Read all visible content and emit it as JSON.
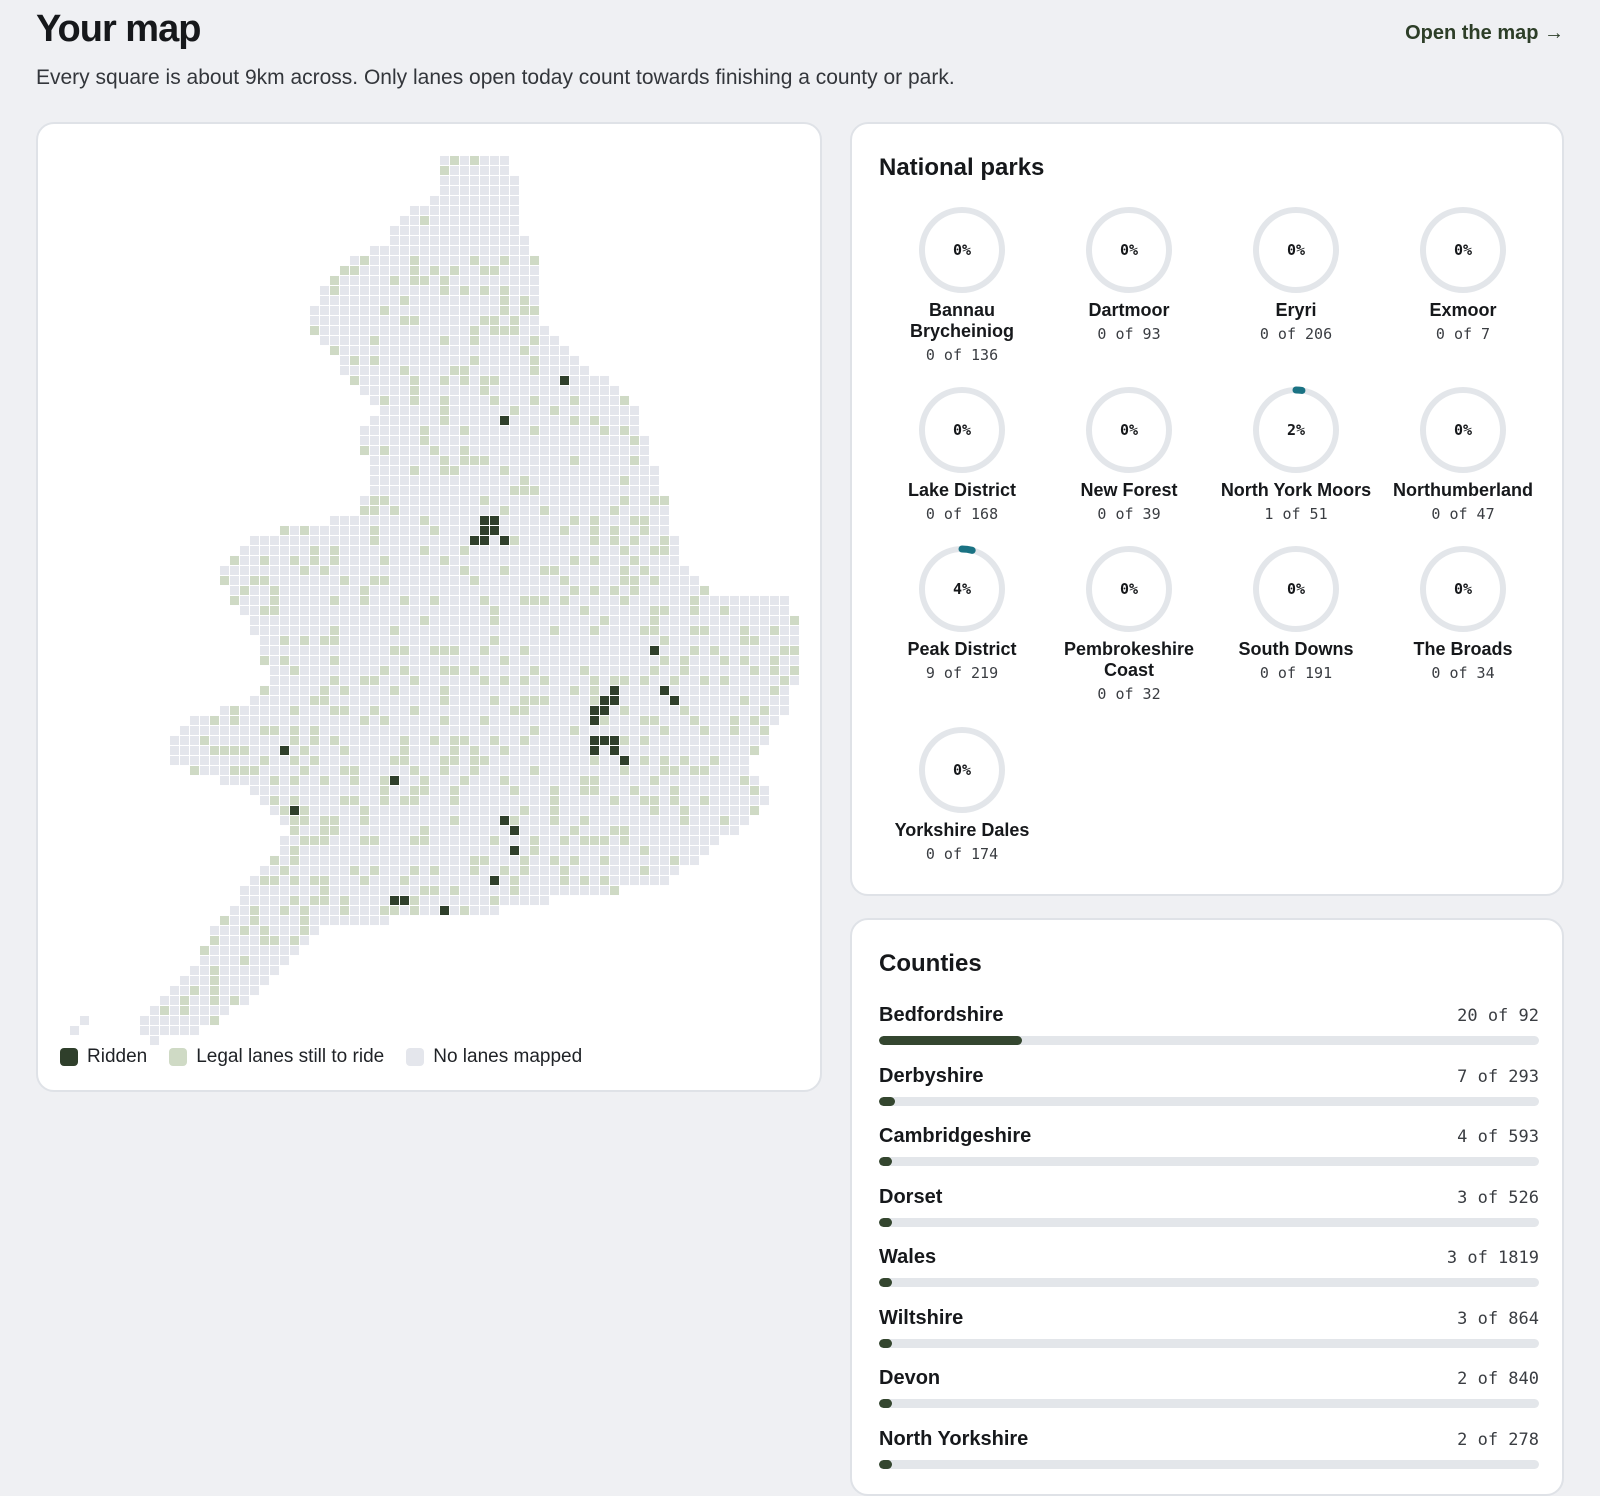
{
  "header": {
    "title": "Your map",
    "open_map_label": "Open the map →",
    "subtitle": "Every square is about 9km across. Only lanes open today count towards finishing a county or park."
  },
  "colors": {
    "ridden": "#2f3f2b",
    "legal": "#cfdac5",
    "none": "#e4e6ec",
    "park_accent": "#1a7283",
    "ring_track": "#e3e6ea"
  },
  "map": {
    "legend": [
      {
        "label": "Ridden",
        "key": "ridden"
      },
      {
        "label": "Legal lanes still to ride",
        "key": "legal"
      },
      {
        "label": "No lanes mapped",
        "key": "none"
      }
    ]
  },
  "parks": {
    "title": "National parks",
    "items": [
      {
        "name": "Bannau Brycheiniog",
        "pct_label": "0%",
        "count": "0 of 136",
        "ridden": 0,
        "total": 136
      },
      {
        "name": "Dartmoor",
        "pct_label": "0%",
        "count": "0 of 93",
        "ridden": 0,
        "total": 93
      },
      {
        "name": "Eryri",
        "pct_label": "0%",
        "count": "0 of 206",
        "ridden": 0,
        "total": 206
      },
      {
        "name": "Exmoor",
        "pct_label": "0%",
        "count": "0 of 7",
        "ridden": 0,
        "total": 7
      },
      {
        "name": "Lake District",
        "pct_label": "0%",
        "count": "0 of 168",
        "ridden": 0,
        "total": 168
      },
      {
        "name": "New Forest",
        "pct_label": "0%",
        "count": "0 of 39",
        "ridden": 0,
        "total": 39
      },
      {
        "name": "North York Moors",
        "pct_label": "2%",
        "count": "1 of 51",
        "ridden": 1,
        "total": 51
      },
      {
        "name": "Northumberland",
        "pct_label": "0%",
        "count": "0 of 47",
        "ridden": 0,
        "total": 47
      },
      {
        "name": "Peak District",
        "pct_label": "4%",
        "count": "9 of 219",
        "ridden": 9,
        "total": 219
      },
      {
        "name": "Pembrokeshire Coast",
        "pct_label": "0%",
        "count": "0 of 32",
        "ridden": 0,
        "total": 32
      },
      {
        "name": "South Downs",
        "pct_label": "0%",
        "count": "0 of 191",
        "ridden": 0,
        "total": 191
      },
      {
        "name": "The Broads",
        "pct_label": "0%",
        "count": "0 of 34",
        "ridden": 0,
        "total": 34
      },
      {
        "name": "Yorkshire Dales",
        "pct_label": "0%",
        "count": "0 of 174",
        "ridden": 0,
        "total": 174
      }
    ]
  },
  "counties": {
    "title": "Counties",
    "items": [
      {
        "name": "Bedfordshire",
        "count": "20 of 92",
        "ridden": 20,
        "total": 92
      },
      {
        "name": "Derbyshire",
        "count": "7 of 293",
        "ridden": 7,
        "total": 293
      },
      {
        "name": "Cambridgeshire",
        "count": "4 of 593",
        "ridden": 4,
        "total": 593
      },
      {
        "name": "Dorset",
        "count": "3 of 526",
        "ridden": 3,
        "total": 526
      },
      {
        "name": "Wales",
        "count": "3 of 1819",
        "ridden": 3,
        "total": 1819
      },
      {
        "name": "Wiltshire",
        "count": "3 of 864",
        "ridden": 3,
        "total": 864
      },
      {
        "name": "Devon",
        "count": "2 of 840",
        "ridden": 2,
        "total": 840
      },
      {
        "name": "North Yorkshire",
        "count": "2 of 278",
        "ridden": 2,
        "total": 278
      }
    ]
  }
}
